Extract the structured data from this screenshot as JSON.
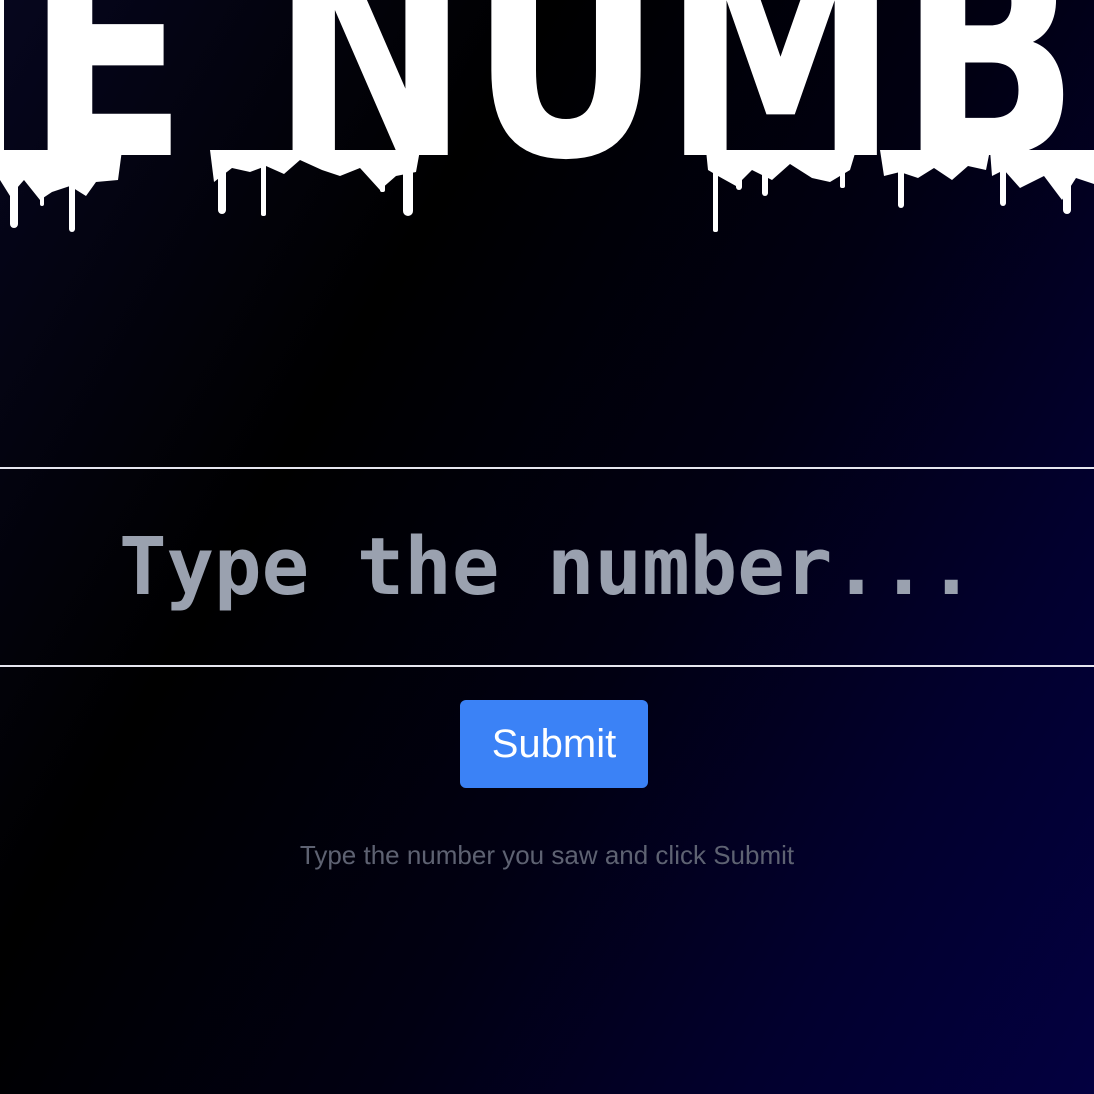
{
  "banner": {
    "title": "THE NUMBER"
  },
  "form": {
    "input_value": "",
    "input_placeholder": "Type the number...",
    "submit_label": "Submit",
    "hint": "Type the number you saw and click Submit"
  },
  "colors": {
    "background_dark": "#000000",
    "background_navy": "#030040",
    "banner_text": "#ffffff",
    "placeholder": "#9aa1af",
    "divider": "#e6e6ef",
    "submit_bg": "#3b82f6",
    "hint_text": "#5e6272"
  }
}
